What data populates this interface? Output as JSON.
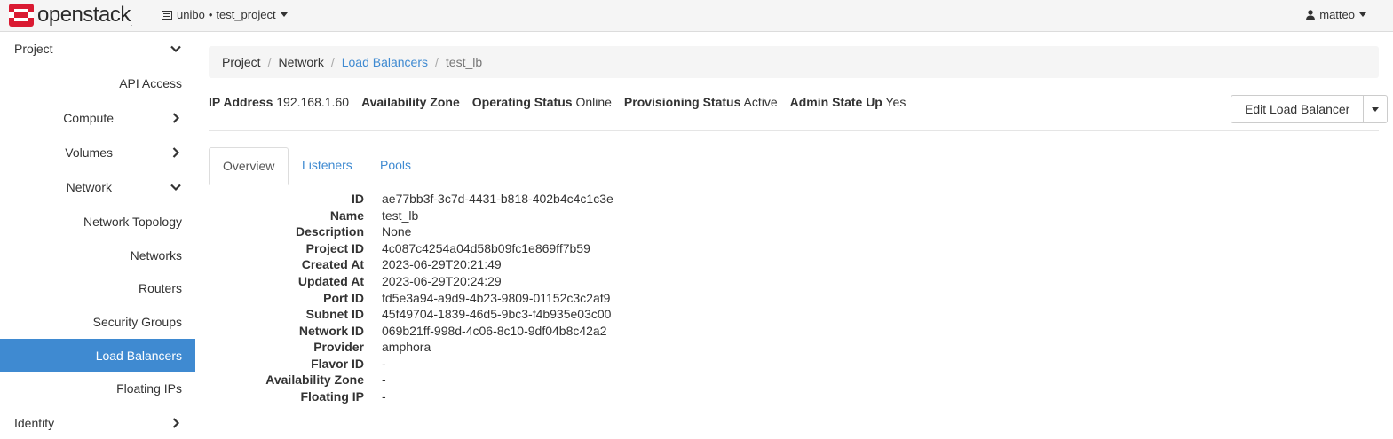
{
  "navbar": {
    "logo_text": "openstack",
    "project_domain": "unibo",
    "project_name": "test_project",
    "user_name": "matteo",
    "brand_color": "#da1a32"
  },
  "sidebar": {
    "items": [
      {
        "label": "Project",
        "chevron": "down"
      },
      {
        "label": "API Access"
      },
      {
        "label": "Compute",
        "chevron": "right"
      },
      {
        "label": "Volumes",
        "chevron": "right"
      },
      {
        "label": "Network",
        "chevron": "down"
      },
      {
        "label": "Network Topology"
      },
      {
        "label": "Networks"
      },
      {
        "label": "Routers"
      },
      {
        "label": "Security Groups"
      },
      {
        "label": "Load Balancers",
        "active": true
      },
      {
        "label": "Floating IPs"
      },
      {
        "label": "Identity",
        "chevron": "right"
      }
    ],
    "active_color": "#3f8ad1"
  },
  "breadcrumb": {
    "items": [
      "Project",
      "Network",
      "Load Balancers",
      "test_lb"
    ],
    "separator": "/"
  },
  "summary": {
    "ip_address_label": "IP Address",
    "ip_address": "192.168.1.60",
    "az_label": "Availability Zone",
    "az_value": "",
    "operating_status_label": "Operating Status",
    "operating_status": "Online",
    "provisioning_status_label": "Provisioning Status",
    "provisioning_status": "Active",
    "admin_state_label": "Admin State Up",
    "admin_state": "Yes"
  },
  "actions": {
    "edit_label": "Edit Load Balancer"
  },
  "tabs": [
    {
      "label": "Overview",
      "active": true
    },
    {
      "label": "Listeners"
    },
    {
      "label": "Pools"
    }
  ],
  "details": [
    {
      "label": "ID",
      "value": "ae77bb3f-3c7d-4431-b818-402b4c4c1c3e"
    },
    {
      "label": "Name",
      "value": "test_lb"
    },
    {
      "label": "Description",
      "value": "None"
    },
    {
      "label": "Project ID",
      "value": "4c087c4254a04d58b09fc1e869ff7b59"
    },
    {
      "label": "Created At",
      "value": "2023-06-29T20:21:49"
    },
    {
      "label": "Updated At",
      "value": "2023-06-29T20:24:29"
    },
    {
      "label": "Port ID",
      "value": "fd5e3a94-a9d9-4b23-9809-01152c3c2af9"
    },
    {
      "label": "Subnet ID",
      "value": "45f49704-1839-46d5-9bc3-f4b935e03c00"
    },
    {
      "label": "Network ID",
      "value": "069b21ff-998d-4c06-8c10-9df04b8c42a2"
    },
    {
      "label": "Provider",
      "value": "amphora"
    },
    {
      "label": "Flavor ID",
      "value": "-"
    },
    {
      "label": "Availability Zone",
      "value": "-"
    },
    {
      "label": "Floating IP",
      "value": "-"
    }
  ]
}
